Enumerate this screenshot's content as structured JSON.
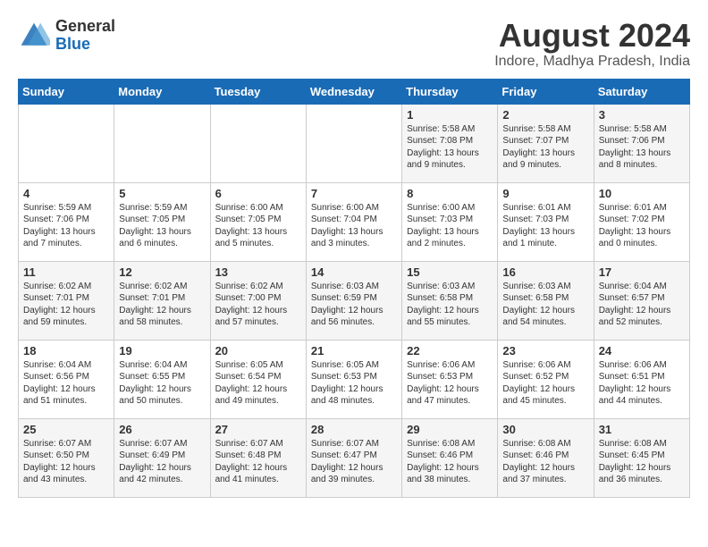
{
  "header": {
    "logo_general": "General",
    "logo_blue": "Blue",
    "title": "August 2024",
    "subtitle": "Indore, Madhya Pradesh, India"
  },
  "days_of_week": [
    "Sunday",
    "Monday",
    "Tuesday",
    "Wednesday",
    "Thursday",
    "Friday",
    "Saturday"
  ],
  "weeks": [
    [
      {
        "day": "",
        "info": ""
      },
      {
        "day": "",
        "info": ""
      },
      {
        "day": "",
        "info": ""
      },
      {
        "day": "",
        "info": ""
      },
      {
        "day": "1",
        "info": "Sunrise: 5:58 AM\nSunset: 7:08 PM\nDaylight: 13 hours\nand 9 minutes."
      },
      {
        "day": "2",
        "info": "Sunrise: 5:58 AM\nSunset: 7:07 PM\nDaylight: 13 hours\nand 9 minutes."
      },
      {
        "day": "3",
        "info": "Sunrise: 5:58 AM\nSunset: 7:06 PM\nDaylight: 13 hours\nand 8 minutes."
      }
    ],
    [
      {
        "day": "4",
        "info": "Sunrise: 5:59 AM\nSunset: 7:06 PM\nDaylight: 13 hours\nand 7 minutes."
      },
      {
        "day": "5",
        "info": "Sunrise: 5:59 AM\nSunset: 7:05 PM\nDaylight: 13 hours\nand 6 minutes."
      },
      {
        "day": "6",
        "info": "Sunrise: 6:00 AM\nSunset: 7:05 PM\nDaylight: 13 hours\nand 5 minutes."
      },
      {
        "day": "7",
        "info": "Sunrise: 6:00 AM\nSunset: 7:04 PM\nDaylight: 13 hours\nand 3 minutes."
      },
      {
        "day": "8",
        "info": "Sunrise: 6:00 AM\nSunset: 7:03 PM\nDaylight: 13 hours\nand 2 minutes."
      },
      {
        "day": "9",
        "info": "Sunrise: 6:01 AM\nSunset: 7:03 PM\nDaylight: 13 hours\nand 1 minute."
      },
      {
        "day": "10",
        "info": "Sunrise: 6:01 AM\nSunset: 7:02 PM\nDaylight: 13 hours\nand 0 minutes."
      }
    ],
    [
      {
        "day": "11",
        "info": "Sunrise: 6:02 AM\nSunset: 7:01 PM\nDaylight: 12 hours\nand 59 minutes."
      },
      {
        "day": "12",
        "info": "Sunrise: 6:02 AM\nSunset: 7:01 PM\nDaylight: 12 hours\nand 58 minutes."
      },
      {
        "day": "13",
        "info": "Sunrise: 6:02 AM\nSunset: 7:00 PM\nDaylight: 12 hours\nand 57 minutes."
      },
      {
        "day": "14",
        "info": "Sunrise: 6:03 AM\nSunset: 6:59 PM\nDaylight: 12 hours\nand 56 minutes."
      },
      {
        "day": "15",
        "info": "Sunrise: 6:03 AM\nSunset: 6:58 PM\nDaylight: 12 hours\nand 55 minutes."
      },
      {
        "day": "16",
        "info": "Sunrise: 6:03 AM\nSunset: 6:58 PM\nDaylight: 12 hours\nand 54 minutes."
      },
      {
        "day": "17",
        "info": "Sunrise: 6:04 AM\nSunset: 6:57 PM\nDaylight: 12 hours\nand 52 minutes."
      }
    ],
    [
      {
        "day": "18",
        "info": "Sunrise: 6:04 AM\nSunset: 6:56 PM\nDaylight: 12 hours\nand 51 minutes."
      },
      {
        "day": "19",
        "info": "Sunrise: 6:04 AM\nSunset: 6:55 PM\nDaylight: 12 hours\nand 50 minutes."
      },
      {
        "day": "20",
        "info": "Sunrise: 6:05 AM\nSunset: 6:54 PM\nDaylight: 12 hours\nand 49 minutes."
      },
      {
        "day": "21",
        "info": "Sunrise: 6:05 AM\nSunset: 6:53 PM\nDaylight: 12 hours\nand 48 minutes."
      },
      {
        "day": "22",
        "info": "Sunrise: 6:06 AM\nSunset: 6:53 PM\nDaylight: 12 hours\nand 47 minutes."
      },
      {
        "day": "23",
        "info": "Sunrise: 6:06 AM\nSunset: 6:52 PM\nDaylight: 12 hours\nand 45 minutes."
      },
      {
        "day": "24",
        "info": "Sunrise: 6:06 AM\nSunset: 6:51 PM\nDaylight: 12 hours\nand 44 minutes."
      }
    ],
    [
      {
        "day": "25",
        "info": "Sunrise: 6:07 AM\nSunset: 6:50 PM\nDaylight: 12 hours\nand 43 minutes."
      },
      {
        "day": "26",
        "info": "Sunrise: 6:07 AM\nSunset: 6:49 PM\nDaylight: 12 hours\nand 42 minutes."
      },
      {
        "day": "27",
        "info": "Sunrise: 6:07 AM\nSunset: 6:48 PM\nDaylight: 12 hours\nand 41 minutes."
      },
      {
        "day": "28",
        "info": "Sunrise: 6:07 AM\nSunset: 6:47 PM\nDaylight: 12 hours\nand 39 minutes."
      },
      {
        "day": "29",
        "info": "Sunrise: 6:08 AM\nSunset: 6:46 PM\nDaylight: 12 hours\nand 38 minutes."
      },
      {
        "day": "30",
        "info": "Sunrise: 6:08 AM\nSunset: 6:46 PM\nDaylight: 12 hours\nand 37 minutes."
      },
      {
        "day": "31",
        "info": "Sunrise: 6:08 AM\nSunset: 6:45 PM\nDaylight: 12 hours\nand 36 minutes."
      }
    ]
  ]
}
